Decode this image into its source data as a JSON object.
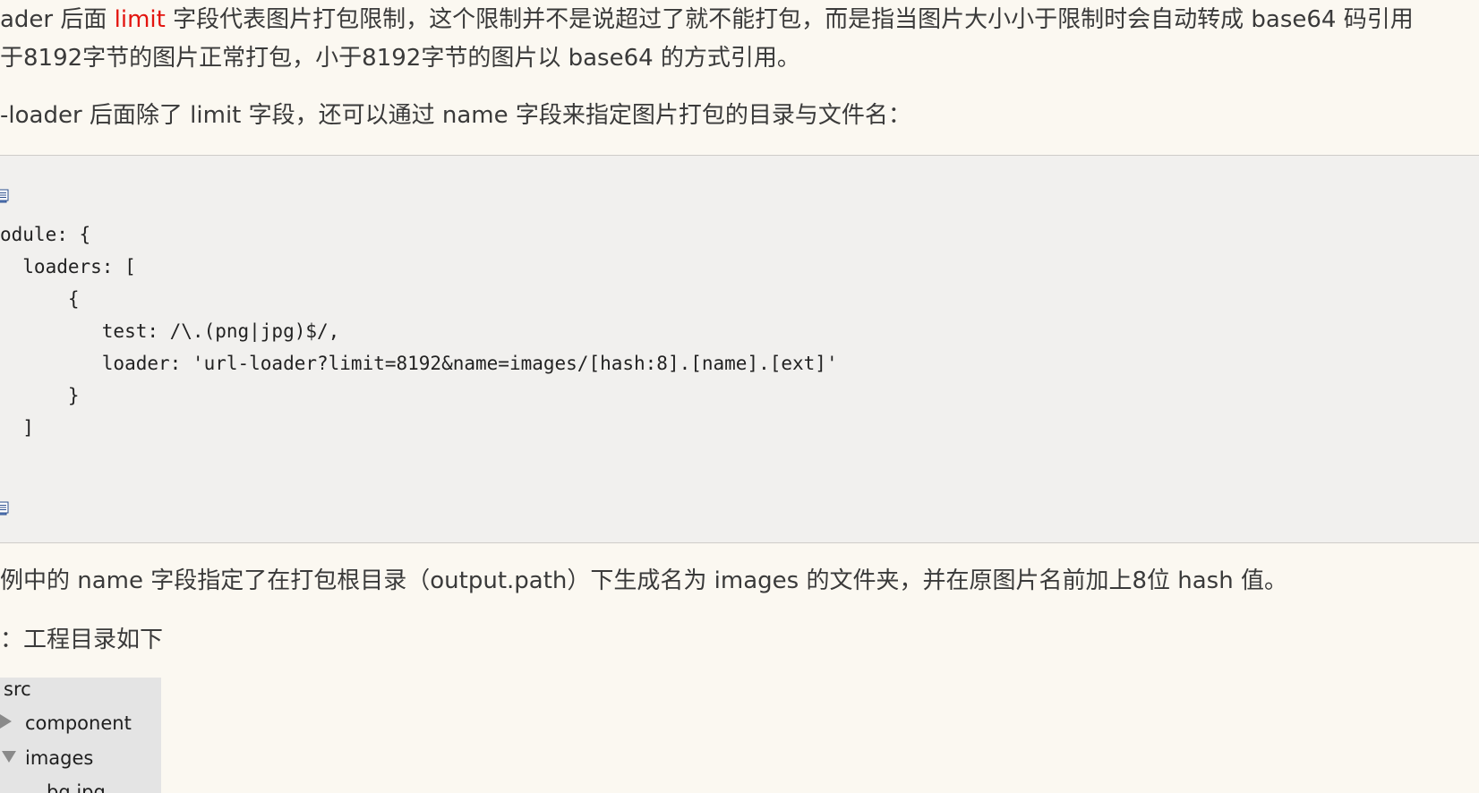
{
  "paragraphs": {
    "p1_prefix": "ader 后面 ",
    "p1_highlight": "limit",
    "p1_suffix": " 字段代表图片打包限制，这个限制并不是说超过了就不能打包，而是指当图片大小小于限制时会自动转成 base64 码引用",
    "p2": "于8192字节的图片正常打包，小于8192字节的图片以 base64 的方式引用。",
    "p3": "-loader 后面除了 limit 字段，还可以通过 name 字段来指定图片打包的目录与文件名：",
    "p4": "例中的 name 字段指定了在打包根目录（output.path）下生成名为 images 的文件夹，并在原图片名前加上8位 hash 值。",
    "p5": "：工程目录如下"
  },
  "code": {
    "top_icon": "copy-code-icon",
    "bottom_icon": "copy-code-icon",
    "lines": [
      "odule: {",
      "  loaders: [",
      "      {",
      "         test: /\\.(png|jpg)$/,",
      "         loader: 'url-loader?limit=8192&name=images/[hash:8].[name].[ext]'",
      "      }",
      "  ]"
    ]
  },
  "file_tree": {
    "root": "src",
    "items": [
      {
        "label": "component",
        "state": "collapsed"
      },
      {
        "label": "images",
        "state": "expanded"
      },
      {
        "label": "bg.jpg",
        "state": "file"
      }
    ]
  },
  "colors": {
    "background": "#fbf8f1",
    "highlight": "#e3140f",
    "code_background": "#f1f0ee",
    "tree_background": "#e4e4e4"
  }
}
